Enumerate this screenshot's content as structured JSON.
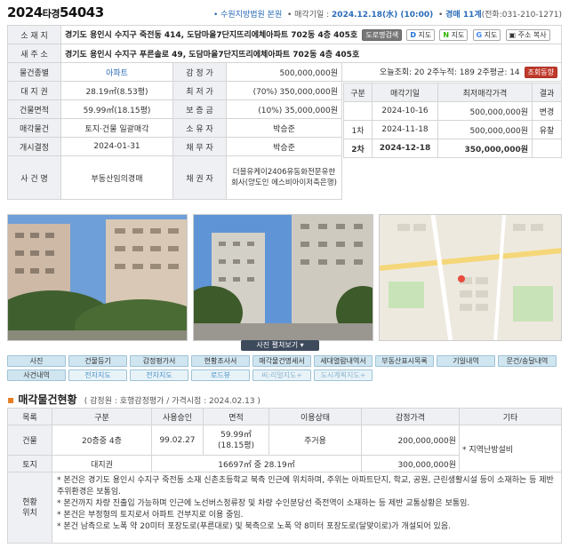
{
  "header": {
    "case_year": "2024",
    "case_type": "타경",
    "case_num": "54043",
    "court": "수원지방법원 본원",
    "date_label": "매각기일 :",
    "date_value": "2024.12.18(水) (10:00)",
    "dept": "경매 11계",
    "phone": "(전화:031-210-1271)"
  },
  "info": {
    "addr_label": "소 재 지",
    "addr": "경기도 용인시 수지구 죽전동 414, 도담마을7단지뜨리에체아파트 702동 4층 405호",
    "btn_road": "도로명검색",
    "btn_map1": "지도",
    "btn_map2": "지도",
    "btn_map3": "지도",
    "btn_copy": "주소 복사",
    "new_addr_label": "새 주 소",
    "new_addr": "경기도 용인시 수지구 푸른솔로 49, 도담마을7단지뜨리에체아파트 702동 4층 405호",
    "rows": [
      {
        "l1": "물건종별",
        "v1": "아파트",
        "l2": "감 정 가",
        "v2": "500,000,000원"
      },
      {
        "l1": "대 지 권",
        "v1": "28.19㎡(8.53평)",
        "l2": "최 저 가",
        "v2": "(70%) 350,000,000원"
      },
      {
        "l1": "건물면적",
        "v1": "59.99㎡(18.15평)",
        "l2": "보 증 금",
        "v2": "(10%) 35,000,000원"
      },
      {
        "l1": "매각물건",
        "v1": "토지·건물 일괄매각",
        "l2": "소 유 자",
        "v2": "박승준"
      },
      {
        "l1": "개시결정",
        "v1": "2024-01-31",
        "l2": "채 무 자",
        "v2": "박승준"
      },
      {
        "l1": "사 건 명",
        "v1": "부동산임의경매",
        "l2": "채 권 자",
        "v2": "더블유케이2406유동화전문유한회사(양도인 에스비아이저축은행)"
      }
    ],
    "views": "오늘조회: 20  2주누적: 189  2주평균: 14",
    "views_btn": "조회동향"
  },
  "history": {
    "headers": [
      "구분",
      "매각기일",
      "최저매각가격",
      "결과"
    ],
    "rows": [
      {
        "round": "",
        "date": "2024-10-16",
        "price": "500,000,000원",
        "result": "변경"
      },
      {
        "round": "1차",
        "date": "2024-11-18",
        "price": "500,000,000원",
        "result": "유찰"
      },
      {
        "round": "2차",
        "date": "2024-12-18",
        "price": "350,000,000원",
        "result": ""
      }
    ]
  },
  "photos": {
    "toggle_label": "사진 펼쳐보기 ▾"
  },
  "tabs": {
    "row1": [
      "사진",
      "건물등기",
      "감정평가서",
      "현황조사서",
      "매각물건명세서",
      "세대열람내역서",
      "부동산표시목록",
      "기일내역",
      "문건/송달내역"
    ],
    "row2": [
      "사건내역",
      "전자지도",
      "전자지도",
      "로드뷰",
      "씨:리얼지도+",
      "도시계획지도+"
    ]
  },
  "property": {
    "title": "매각물건현황",
    "note": "( 감정원 : 호행감정평가 / 가격시점 : 2024.02.13 )",
    "headers": [
      "목록",
      "구분",
      "사용승인",
      "면적",
      "이용상태",
      "감정가격",
      "기타"
    ],
    "building": {
      "label": "건물",
      "kind": "20층중 4층",
      "approval": "99.02.27",
      "area1": "59.99㎡",
      "area2": "(18.15평)",
      "usage": "주거용",
      "price": "200,000,000원"
    },
    "land": {
      "label": "토지",
      "kind": "대지권",
      "area": "16697㎡ 중 28.19㎡",
      "price": "300,000,000원"
    },
    "etc": "* 지역난방설비",
    "status_label1": "현황",
    "status_label2": "위치",
    "bullets": [
      "* 본건은 경기도 용인시 수지구 죽전동 소재 신촌초등학교 북측 인근에 위치하며, 주위는 아파트단지, 학교, 공원, 근린생활시설 등이 소재하는 등 제반 주위환경은 보통임.",
      "* 본건까지 차량 진출입 가능하며 인근에 노선버스정류장 및 차량 수인분당선 죽전역이 소재하는 등 제반 교통상황은 보통임.",
      "* 본건은 부정형의 토지로서 아파트 건부지로 이용 중임.",
      "* 본건 남측으로 노폭 약 20미터 포장도로(푸른대로) 및 북측으로 노폭 약 8미터 포장도로(달맞이로)가 개설되어 있음."
    ]
  },
  "colors": {
    "accent_blue": "#2b6cb8",
    "label_bg": "#eef0f3",
    "tab_bg": "#cfe5f0",
    "bullet_orange": "#e67e22"
  }
}
